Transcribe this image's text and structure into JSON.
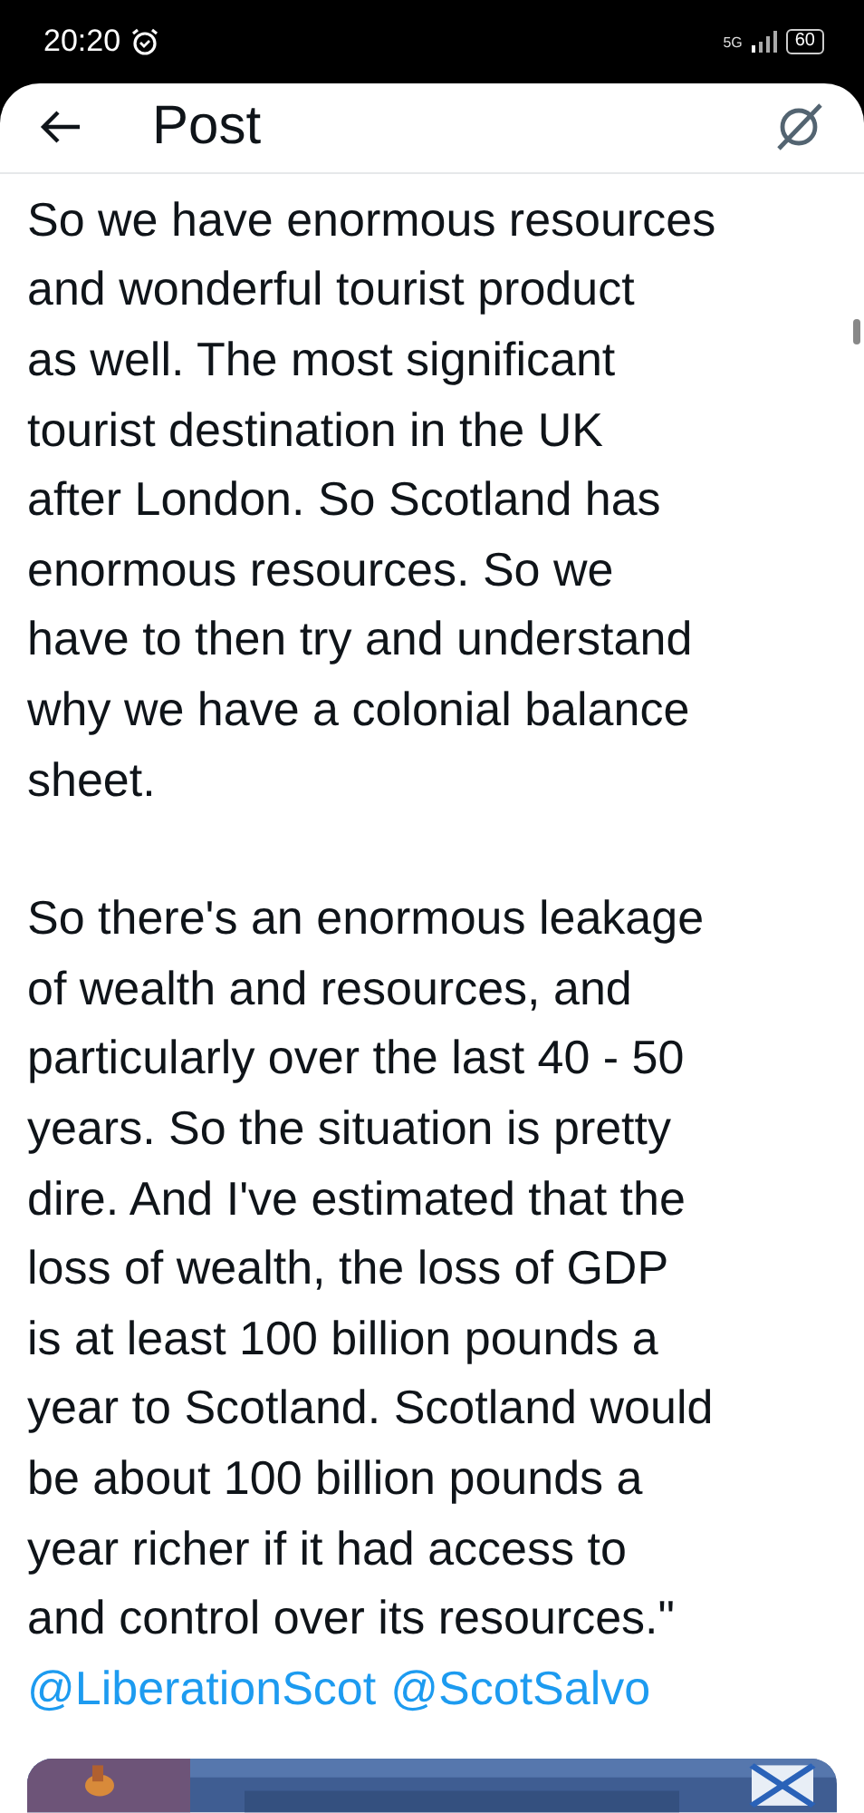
{
  "status_bar": {
    "time": "20:20",
    "network": "5G",
    "battery": "60"
  },
  "header": {
    "title": "Post"
  },
  "post": {
    "paragraphs": [
      [
        "So we have enormous resources",
        "and wonderful tourist product",
        "as well. The most significant",
        "tourist destination in the UK",
        "after London. So Scotland has",
        "enormous resources. So we",
        "have to then try and understand",
        "why we have a colonial balance",
        "sheet."
      ],
      [
        "So there's an enormous leakage",
        "of wealth and resources, and",
        "particularly over the last 40 - 50",
        "years. So the situation is pretty",
        "dire. And I've estimated that the",
        "loss of wealth, the loss of GDP",
        "is at least 100 billion pounds a",
        "year to Scotland. Scotland would",
        "be about 100 billion pounds a",
        "year richer if it had access to",
        "and control over its resources.\""
      ]
    ],
    "mentions": [
      "@LiberationScot",
      "@ScotSalvo"
    ]
  }
}
